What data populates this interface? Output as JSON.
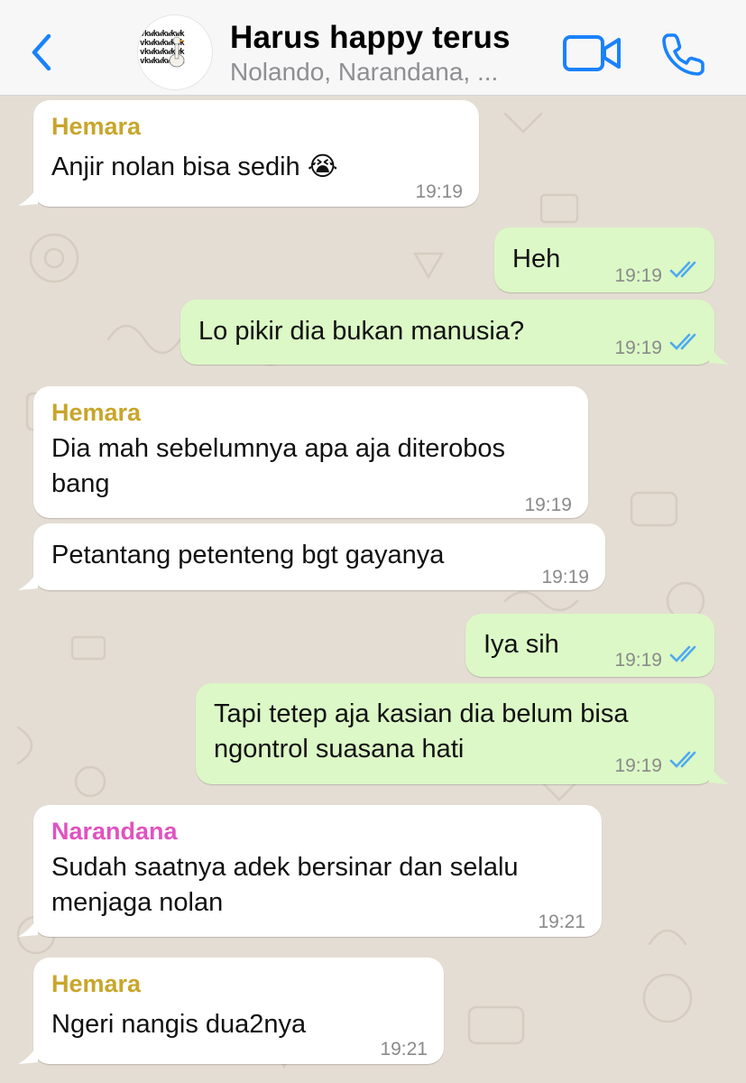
{
  "header": {
    "back_icon": "chevron-left-icon",
    "group_name": "Harus happy terus",
    "members": "Nolando, Narandana, ...",
    "avatar_text": "vkwkwkwkwk",
    "video_icon": "video-camera-icon",
    "call_icon": "phone-icon",
    "accent_color": "#1a82fb"
  },
  "colors": {
    "incoming_bubble": "#ffffff",
    "outgoing_bubble": "#dcf8c6",
    "wallpaper": "#e4ddd3",
    "hemara_name": "#c8a62b",
    "narandana_name": "#e052c0",
    "read_ticks": "#4fa9f0"
  },
  "messages": [
    {
      "sender": "Hemara",
      "text": "Anjir nolan bisa sedih 😭",
      "time": "19:19"
    },
    {
      "text": "Heh",
      "time": "19:19",
      "status": "read"
    },
    {
      "text": "Lo pikir dia bukan manusia?",
      "time": "19:19",
      "status": "read"
    },
    {
      "sender": "Hemara",
      "text_line1": "Dia mah sebelumnya apa aja diterobos",
      "text_line2": "bang",
      "time": "19:19"
    },
    {
      "text": "Petantang petenteng bgt gayanya",
      "time": "19:19"
    },
    {
      "text": "Iya sih",
      "time": "19:19",
      "status": "read"
    },
    {
      "text_line1": "Tapi tetep aja kasian dia belum bisa",
      "text_line2": "ngontrol suasana hati",
      "time": "19:19",
      "status": "read"
    },
    {
      "sender": "Narandana",
      "text_line1": "Sudah saatnya adek bersinar dan selalu",
      "text_line2": "menjaga nolan",
      "time": "19:21"
    },
    {
      "sender": "Hemara",
      "text": "Ngeri nangis dua2nya",
      "time": "19:21"
    }
  ]
}
